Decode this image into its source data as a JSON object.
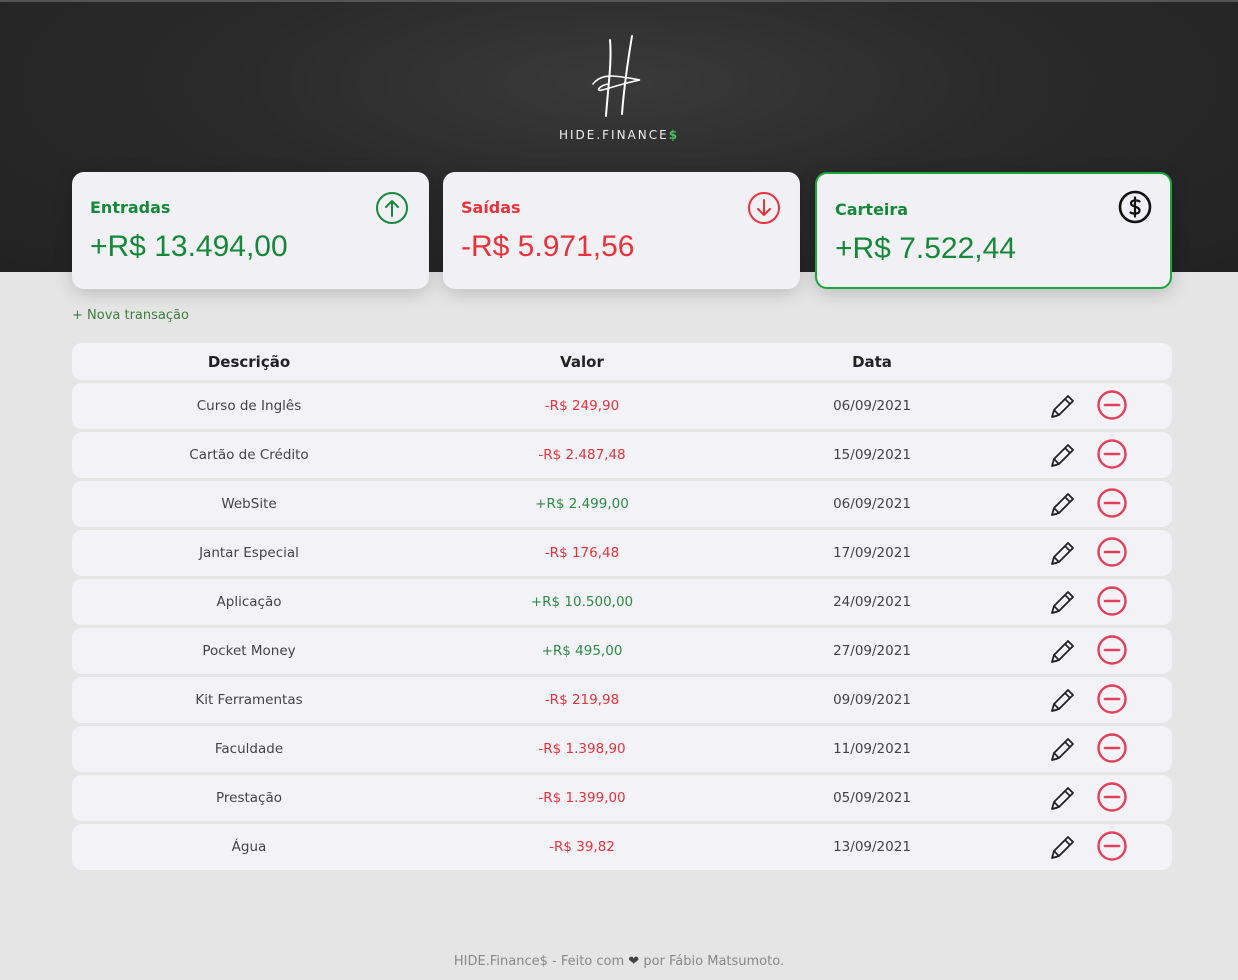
{
  "brand": {
    "logo_text": "HIDE.FINANCE",
    "logo_dollar": "$",
    "logo_icon": "h-signature-logo"
  },
  "cards": {
    "income": {
      "label": "Entradas",
      "value": "+R$ 13.494,00",
      "icon": "arrow-up-circle-icon",
      "color": "#16883a"
    },
    "expense": {
      "label": "Saídas",
      "value": "-R$ 5.971,56",
      "icon": "arrow-down-circle-icon",
      "color": "#e8323c"
    },
    "wallet": {
      "label": "Carteira",
      "value": "+R$ 7.522,44",
      "icon": "dollar-circle-icon",
      "color": "#16883a"
    }
  },
  "actions": {
    "new_transaction": "+ Nova transação"
  },
  "table": {
    "headers": {
      "description": "Descrição",
      "value": "Valor",
      "date": "Data"
    },
    "rows": [
      {
        "description": "Curso de Inglês",
        "value": "-R$ 249,90",
        "date": "06/09/2021",
        "type": "neg"
      },
      {
        "description": "Cartão de Crédito",
        "value": "-R$ 2.487,48",
        "date": "15/09/2021",
        "type": "neg"
      },
      {
        "description": "WebSite",
        "value": "+R$ 2.499,00",
        "date": "06/09/2021",
        "type": "pos"
      },
      {
        "description": "Jantar Especial",
        "value": "-R$ 176,48",
        "date": "17/09/2021",
        "type": "neg"
      },
      {
        "description": "Aplicação",
        "value": "+R$ 10.500,00",
        "date": "24/09/2021",
        "type": "pos"
      },
      {
        "description": "Pocket Money",
        "value": "+R$ 495,00",
        "date": "27/09/2021",
        "type": "pos"
      },
      {
        "description": "Kit Ferramentas",
        "value": "-R$ 219,98",
        "date": "09/09/2021",
        "type": "neg"
      },
      {
        "description": "Faculdade",
        "value": "-R$ 1.398,90",
        "date": "11/09/2021",
        "type": "neg"
      },
      {
        "description": "Prestação",
        "value": "-R$ 1.399,00",
        "date": "05/09/2021",
        "type": "neg"
      },
      {
        "description": "Água",
        "value": "-R$ 39,82",
        "date": "13/09/2021",
        "type": "neg"
      }
    ]
  },
  "footer": {
    "before": "HIDE.Finance$ - Feito com",
    "after": "por Fábio Matsumoto."
  },
  "colors": {
    "positive": "#2e8b45",
    "negative": "#e8323c",
    "wallet_border": "#1aa83a",
    "accent_dollar": "#49c05b"
  }
}
